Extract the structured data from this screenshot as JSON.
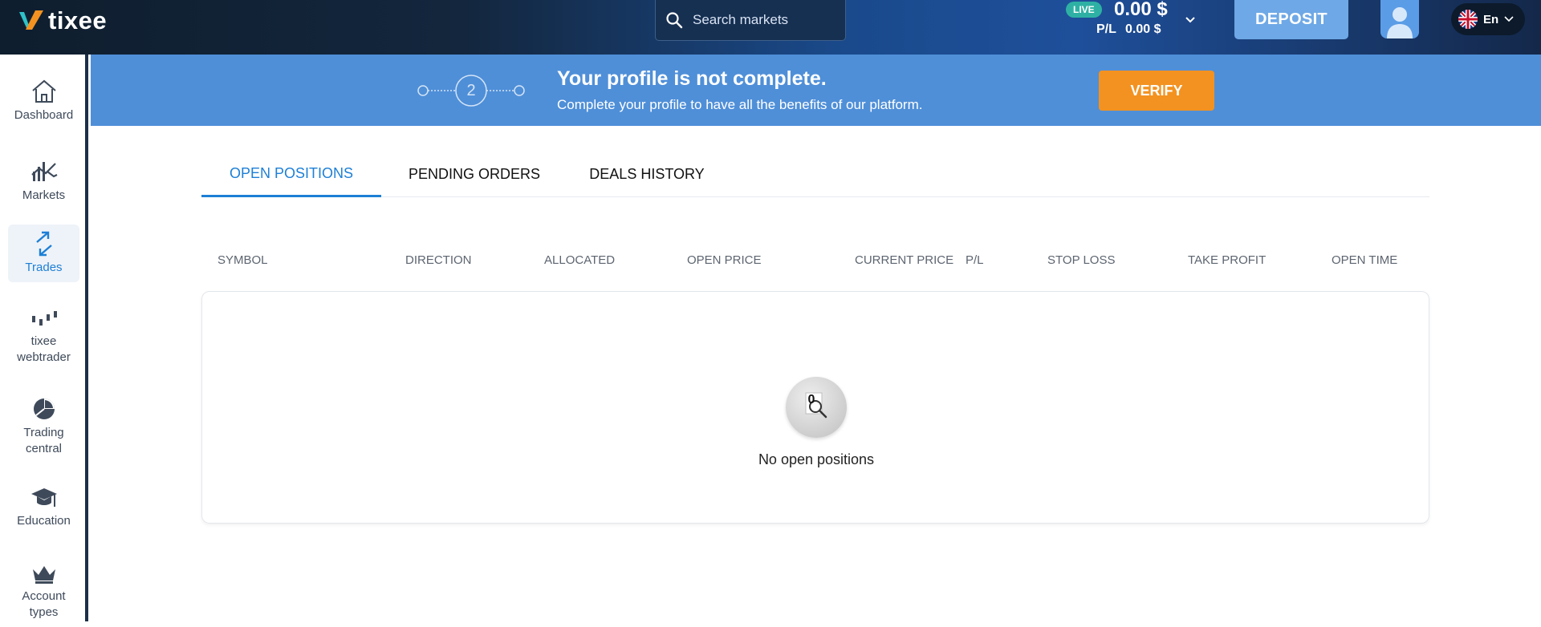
{
  "header": {
    "logo_text": "tixee",
    "search_placeholder": "Search markets",
    "account_mode": "LIVE",
    "balance": "0.00 $",
    "pl_label": "P/L",
    "pl_value": "0.00 $",
    "deposit_label": "DEPOSIT",
    "language": "En"
  },
  "sidebar": {
    "items": [
      {
        "label": "Dashboard",
        "icon": "home-icon"
      },
      {
        "label": "Markets",
        "icon": "chart-icon"
      },
      {
        "label": "Trades",
        "icon": "trades-arrows-icon",
        "active": true
      },
      {
        "label": "tixee webtrader",
        "icon": "candlestick-icon"
      },
      {
        "label": "Trading central",
        "icon": "pie-chart-icon"
      },
      {
        "label": "Education",
        "icon": "graduation-cap-icon"
      },
      {
        "label": "Account types",
        "icon": "crown-icon"
      }
    ]
  },
  "banner": {
    "step_number": "2",
    "title": "Your profile is not complete.",
    "subtitle": "Complete your profile to have all the benefits of our platform.",
    "verify_label": "VERIFY"
  },
  "tabs": [
    {
      "label": "OPEN POSITIONS",
      "active": true
    },
    {
      "label": "PENDING ORDERS"
    },
    {
      "label": "DEALS HISTORY"
    }
  ],
  "table": {
    "columns": [
      "SYMBOL",
      "DIRECTION",
      "ALLOCATED",
      "OPEN PRICE",
      "CURRENT PRICE",
      "P/L",
      "STOP LOSS",
      "TAKE PROFIT",
      "OPEN TIME"
    ],
    "empty_badge": "0",
    "empty_message": "No open positions"
  },
  "colors": {
    "accent": "#1d7fd6",
    "banner": "#4f8fd8",
    "verify": "#f39220",
    "deposit": "#6ea8e6",
    "live_badge": "#2eb1a4"
  }
}
